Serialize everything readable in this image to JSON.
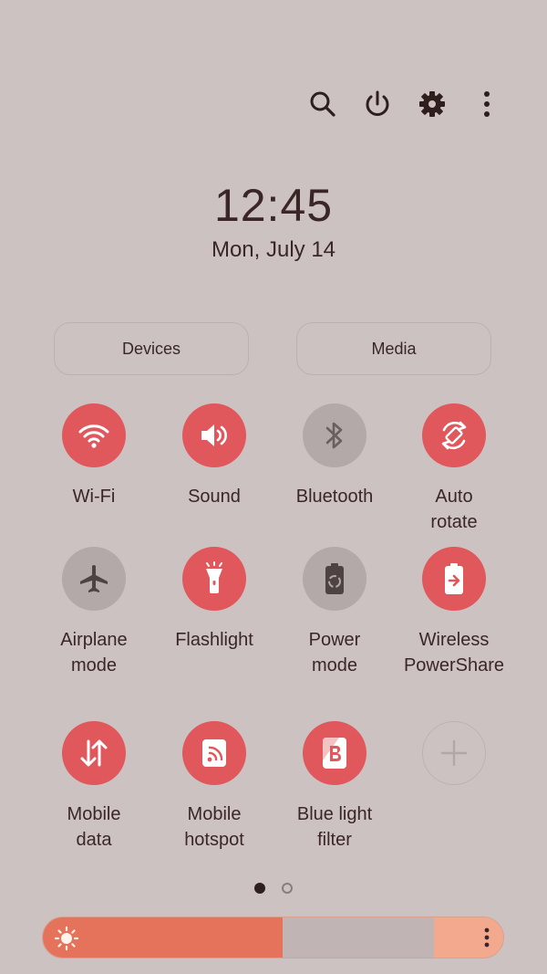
{
  "header": {
    "time": "12:45",
    "date": "Mon, July 14",
    "icons": [
      "search-icon",
      "power-icon",
      "settings-icon",
      "more-vert-icon"
    ]
  },
  "buttons": {
    "devices": "Devices",
    "media": "Media"
  },
  "tiles": [
    {
      "label": "Wi-Fi",
      "icon": "wifi-icon",
      "state": "on"
    },
    {
      "label": "Sound",
      "icon": "sound-icon",
      "state": "on"
    },
    {
      "label": "Bluetooth",
      "icon": "bluetooth-icon",
      "state": "off"
    },
    {
      "label": "Auto\nrotate",
      "icon": "auto-rotate-icon",
      "state": "on"
    },
    {
      "label": "Airplane\nmode",
      "icon": "airplane-icon",
      "state": "off"
    },
    {
      "label": "Flashlight",
      "icon": "flashlight-icon",
      "state": "on"
    },
    {
      "label": "Power\nmode",
      "icon": "power-mode-icon",
      "state": "off"
    },
    {
      "label": "Wireless\nPowerShare",
      "icon": "wireless-powershare-icon",
      "state": "on"
    },
    {
      "label": "Mobile\ndata",
      "icon": "mobile-data-icon",
      "state": "on"
    },
    {
      "label": "Mobile\nhotspot",
      "icon": "hotspot-icon",
      "state": "on"
    },
    {
      "label": "Blue light\nfilter",
      "icon": "blue-light-filter-icon",
      "state": "on"
    },
    {
      "label": "",
      "icon": "add-icon",
      "state": "add"
    }
  ],
  "pager": {
    "pages": 2,
    "current": 1
  },
  "brightness": {
    "level": 0.52,
    "icon": "sun-icon"
  },
  "colors": {
    "background": "#cdc2c2",
    "tile_on": "#e0575c",
    "tile_off": "#b3a9a9",
    "brightness_fill": "#e5735b",
    "text": "#3a2626"
  }
}
